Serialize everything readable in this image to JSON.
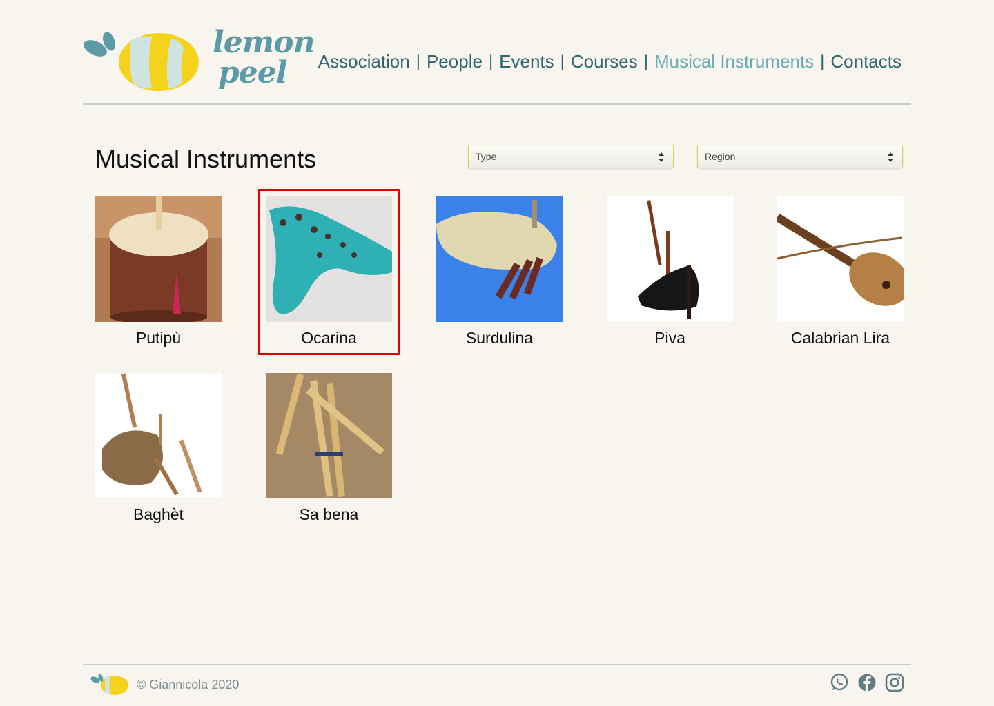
{
  "brand": {
    "logo_line1": "lemon",
    "logo_line2": "peel",
    "logo_icon": "lemon-logo-icon"
  },
  "nav": {
    "items": [
      {
        "label": "Association"
      },
      {
        "label": "People"
      },
      {
        "label": "Events"
      },
      {
        "label": "Courses"
      },
      {
        "label": "Musical Instruments",
        "active": true
      },
      {
        "label": "Contacts"
      }
    ],
    "separator": "|"
  },
  "page": {
    "title": "Musical Instruments"
  },
  "filters": {
    "type": {
      "value": "Type"
    },
    "region": {
      "value": "Region"
    }
  },
  "instruments": [
    {
      "name": "Putipù",
      "image": "drum-photo"
    },
    {
      "name": "Ocarina",
      "image": "ocarina-photo",
      "selected": true
    },
    {
      "name": "Surdulina",
      "image": "bagpipe-photo"
    },
    {
      "name": "Piva",
      "image": "bagpipe-black-photo"
    },
    {
      "name": "Calabrian Lira",
      "image": "lira-photo"
    },
    {
      "name": "Baghèt",
      "image": "bagpipe-leather-photo"
    },
    {
      "name": "Sa bena",
      "image": "reed-pipes-photo"
    }
  ],
  "footer": {
    "copyright": "© Giannicola 2020",
    "social": [
      "whatsapp-icon",
      "facebook-icon",
      "instagram-icon"
    ]
  },
  "colors": {
    "background": "#f8f4ee",
    "nav": "#2f6470",
    "nav_active": "#6aabb6",
    "selection": "#e00000",
    "lemon": "#f5d21c"
  }
}
